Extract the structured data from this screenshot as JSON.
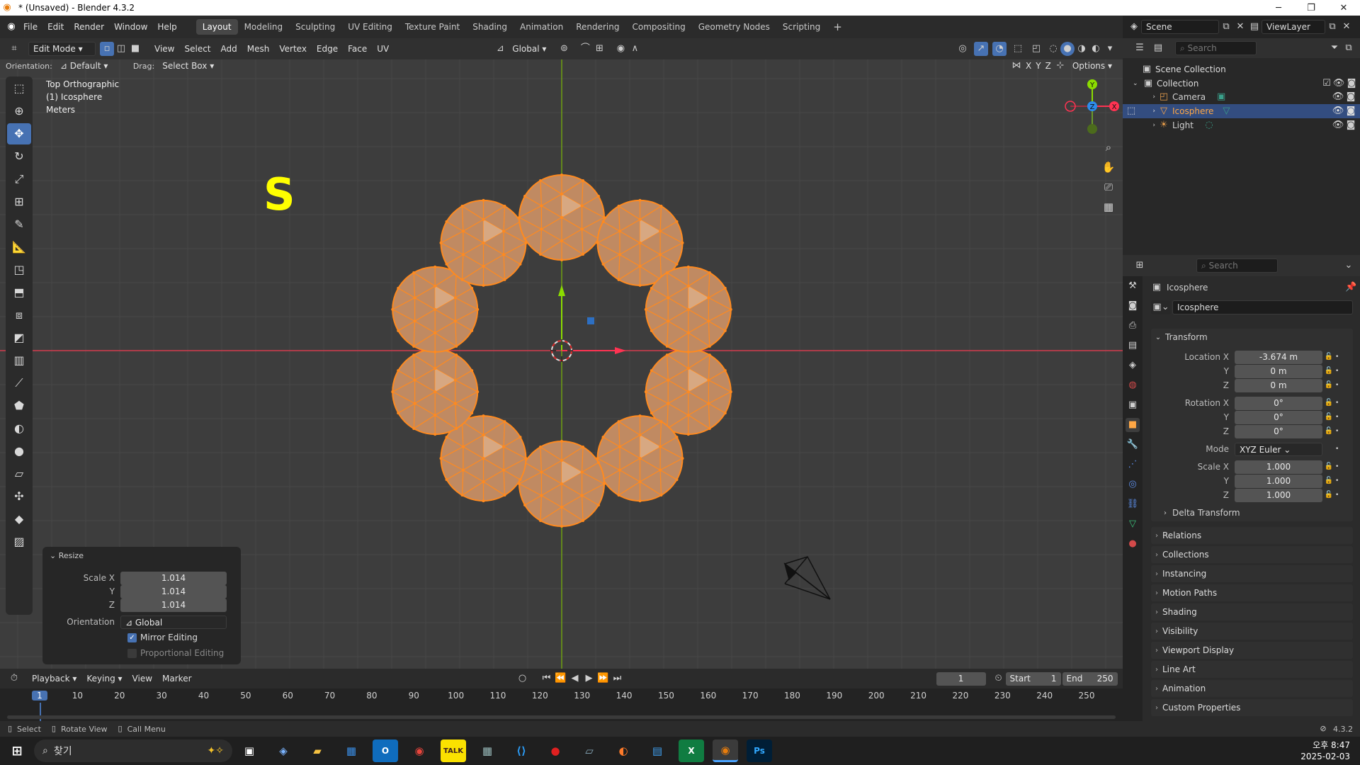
{
  "window": {
    "title": "* (Unsaved) - Blender 4.3.2",
    "minimize": "─",
    "maximize": "❐",
    "close": "✕"
  },
  "menu": [
    "File",
    "Edit",
    "Render",
    "Window",
    "Help"
  ],
  "workspaces": [
    "Layout",
    "Modeling",
    "Sculpting",
    "UV Editing",
    "Texture Paint",
    "Shading",
    "Animation",
    "Rendering",
    "Compositing",
    "Geometry Nodes",
    "Scripting"
  ],
  "active_workspace": "Layout",
  "add_workspace": "+",
  "scene": {
    "scene_label": "Scene",
    "view_layer": "ViewLayer"
  },
  "viewport_header": {
    "mode": "Edit Mode",
    "menus": [
      "View",
      "Select",
      "Add",
      "Mesh",
      "Vertex",
      "Edge",
      "Face",
      "UV"
    ],
    "orientation": "Global"
  },
  "tool_settings": {
    "orientation_label": "Orientation:",
    "orientation_value": "Default",
    "drag_label": "Drag:",
    "drag_value": "Select Box",
    "options": "Options",
    "axes": [
      "X",
      "Y",
      "Z"
    ]
  },
  "overlay_text": {
    "view": "Top Orthographic",
    "object": "(1) Icosphere",
    "units": "Meters",
    "key": "S"
  },
  "gizmo": {
    "x": "X",
    "y": "Y",
    "z": "Z"
  },
  "resize_panel": {
    "title": "Resize",
    "scale_label": "Scale X",
    "y_label": "Y",
    "z_label": "Z",
    "scale_x": "1.014",
    "scale_y": "1.014",
    "scale_z": "1.014",
    "orientation_label": "Orientation",
    "orientation_value": "Global",
    "mirror_editing": "Mirror Editing",
    "proportional_editing": "Proportional Editing",
    "mirror_checked": true,
    "proportional_checked": false
  },
  "timeline": {
    "menus": [
      "Playback",
      "Keying",
      "View",
      "Marker"
    ],
    "current_frame": "1",
    "start_label": "Start",
    "start": "1",
    "end_label": "End",
    "end": "250",
    "ticks": [
      "1",
      "10",
      "20",
      "30",
      "40",
      "50",
      "60",
      "70",
      "80",
      "90",
      "100",
      "110",
      "120",
      "130",
      "140",
      "150",
      "160",
      "170",
      "180",
      "190",
      "200",
      "210",
      "220",
      "230",
      "240",
      "250"
    ]
  },
  "status_bar": {
    "select": "Select",
    "rotate": "Rotate View",
    "menu": "Call Menu",
    "version": "4.3.2"
  },
  "outliner": {
    "search_placeholder": "Search",
    "root": "Scene Collection",
    "collection": "Collection",
    "items": [
      {
        "label": "Camera",
        "selected": false,
        "icon": "camera-icon"
      },
      {
        "label": "Icosphere",
        "selected": true,
        "icon": "mesh-icon"
      },
      {
        "label": "Light",
        "selected": false,
        "icon": "light-icon"
      }
    ]
  },
  "properties": {
    "search_placeholder": "Search",
    "object_name": "Icosphere",
    "object_field": "Icosphere",
    "transform": {
      "title": "Transform",
      "location_label": "Location X",
      "loc_x": "-3.674 m",
      "loc_y": "0 m",
      "loc_z": "0 m",
      "rotation_label": "Rotation X",
      "rot_x": "0°",
      "rot_y": "0°",
      "rot_z": "0°",
      "mode_label": "Mode",
      "mode_value": "XYZ Euler",
      "scale_label": "Scale X",
      "scale_x": "1.000",
      "scale_y": "1.000",
      "scale_z": "1.000",
      "y_label": "Y",
      "z_label": "Z"
    },
    "delta": "Delta Transform",
    "panels": [
      "Relations",
      "Collections",
      "Instancing",
      "Motion Paths",
      "Shading",
      "Visibility",
      "Viewport Display",
      "Line Art",
      "Animation",
      "Custom Properties"
    ]
  },
  "taskbar": {
    "search": "찾기",
    "time": "오후 8:47",
    "date": "2025-02-03"
  },
  "colors": {
    "accent": "#4772b3",
    "select_orange": "#ff8a1f",
    "mesh_face": "#c08a62",
    "x_axis": "#ff3352",
    "y_axis": "#8bdc00",
    "z_axis": "#2d8ceb",
    "key_text": "#ffff00"
  }
}
